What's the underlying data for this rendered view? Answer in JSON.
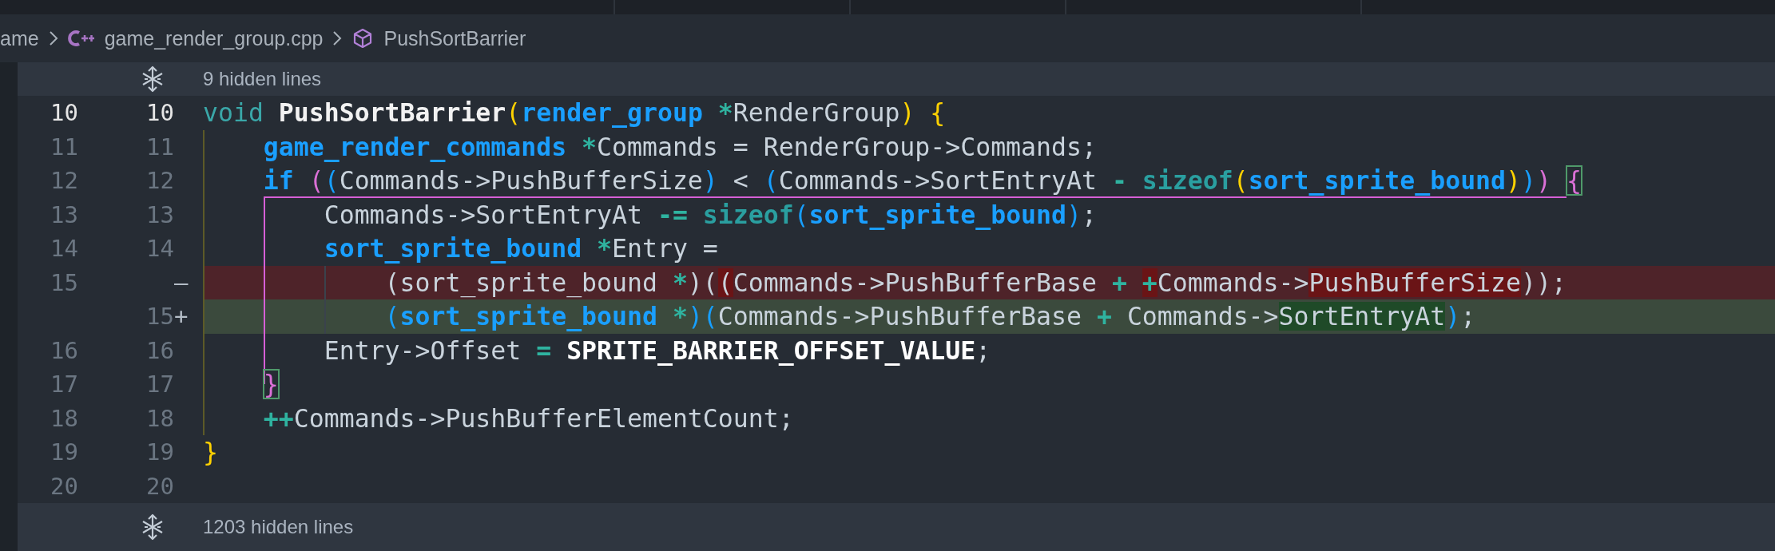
{
  "breadcrumb": [
    {
      "kind": "folder",
      "label": "ame"
    },
    {
      "kind": "file",
      "label": "game_render_group.cpp"
    },
    {
      "kind": "symbol",
      "label": "PushSortBarrier"
    }
  ],
  "top_fold": {
    "text": "9 hidden lines"
  },
  "lines": [
    {
      "old": "10",
      "new": "10",
      "kind": "context",
      "current": true,
      "tokens": [
        {
          "text": "void ",
          "kind": "keyword",
          "changed": false
        },
        {
          "text": "PushSortBarrier",
          "kind": "function",
          "changed": false
        },
        {
          "text": "(",
          "kind": "paren-1",
          "changed": false
        },
        {
          "text": "render_group ",
          "kind": "type",
          "changed": false
        },
        {
          "text": "*",
          "kind": "operator",
          "changed": false
        },
        {
          "text": "RenderGroup",
          "kind": "plain",
          "changed": false
        },
        {
          "text": ") ",
          "kind": "paren-1",
          "changed": false
        },
        {
          "text": "{",
          "kind": "paren-1",
          "changed": false
        }
      ]
    },
    {
      "old": "11",
      "new": "11",
      "kind": "context",
      "current": false,
      "tokens": [
        {
          "text": "    game_render_commands ",
          "kind": "type",
          "changed": false
        },
        {
          "text": "*",
          "kind": "operator",
          "changed": false
        },
        {
          "text": "Commands = RenderGroup->Commands;",
          "kind": "plain",
          "changed": false
        }
      ]
    },
    {
      "old": "12",
      "new": "12",
      "kind": "context",
      "current": false,
      "tokens": [
        {
          "text": "    if ",
          "kind": "control",
          "changed": false
        },
        {
          "text": "(",
          "kind": "paren-2",
          "changed": false
        },
        {
          "text": "(",
          "kind": "paren-3",
          "changed": false
        },
        {
          "text": "Commands->PushBufferSize",
          "kind": "plain",
          "changed": false
        },
        {
          "text": ")",
          "kind": "paren-3",
          "changed": false
        },
        {
          "text": " < ",
          "kind": "plain",
          "changed": false
        },
        {
          "text": "(",
          "kind": "paren-3",
          "changed": false
        },
        {
          "text": "Commands->SortEntryAt ",
          "kind": "plain",
          "changed": false
        },
        {
          "text": "- ",
          "kind": "operator",
          "changed": false
        },
        {
          "text": "sizeof",
          "kind": "builtin",
          "changed": false
        },
        {
          "text": "(",
          "kind": "paren-1",
          "changed": false
        },
        {
          "text": "sort_sprite_bound",
          "kind": "type",
          "changed": false
        },
        {
          "text": ")",
          "kind": "paren-1",
          "changed": false
        },
        {
          "text": ")",
          "kind": "paren-3",
          "changed": false
        },
        {
          "text": ") ",
          "kind": "paren-2",
          "changed": false
        },
        {
          "text": "{",
          "kind": "brace-match",
          "changed": false
        }
      ]
    },
    {
      "old": "13",
      "new": "13",
      "kind": "context",
      "current": false,
      "tokens": [
        {
          "text": "        Commands->SortEntryAt ",
          "kind": "plain",
          "changed": false
        },
        {
          "text": "-= ",
          "kind": "operator",
          "changed": false
        },
        {
          "text": "sizeof",
          "kind": "builtin",
          "changed": false
        },
        {
          "text": "(",
          "kind": "paren-3",
          "changed": false
        },
        {
          "text": "sort_sprite_bound",
          "kind": "type",
          "changed": false
        },
        {
          "text": ")",
          "kind": "paren-3",
          "changed": false
        },
        {
          "text": ";",
          "kind": "plain",
          "changed": false
        }
      ]
    },
    {
      "old": "14",
      "new": "14",
      "kind": "context",
      "current": false,
      "tokens": [
        {
          "text": "        sort_sprite_bound ",
          "kind": "type",
          "changed": false
        },
        {
          "text": "*",
          "kind": "operator",
          "changed": false
        },
        {
          "text": "Entry =",
          "kind": "plain",
          "changed": false
        }
      ]
    },
    {
      "old": "15",
      "marker": "—",
      "kind": "removed",
      "current": false,
      "tokens": [
        {
          "text": "            (sort_sprite_bound ",
          "kind": "plain",
          "changed": false
        },
        {
          "text": "*",
          "kind": "operator",
          "changed": false
        },
        {
          "text": ")(",
          "kind": "plain",
          "changed": false
        },
        {
          "text": "(",
          "kind": "plain",
          "changed": true
        },
        {
          "text": "Commands->PushBufferBase ",
          "kind": "plain",
          "changed": false
        },
        {
          "text": "+ ",
          "kind": "operator",
          "changed": false
        },
        {
          "text": "+",
          "kind": "operator",
          "changed": true
        },
        {
          "text": "Commands->",
          "kind": "plain",
          "changed": false
        },
        {
          "text": "PushBufferSize",
          "kind": "plain",
          "changed": true
        },
        {
          "text": "));",
          "kind": "plain",
          "changed": false
        }
      ]
    },
    {
      "new": "15",
      "marker": "+",
      "kind": "added",
      "current": false,
      "tokens": [
        {
          "text": "            (",
          "kind": "paren-3",
          "changed": false
        },
        {
          "text": "sort_sprite_bound ",
          "kind": "type",
          "changed": false
        },
        {
          "text": "*",
          "kind": "operator",
          "changed": false
        },
        {
          "text": ")(",
          "kind": "paren-3",
          "changed": false
        },
        {
          "text": "Commands->PushBufferBase ",
          "kind": "plain",
          "changed": false
        },
        {
          "text": "+ ",
          "kind": "operator",
          "changed": false
        },
        {
          "text": "Commands->",
          "kind": "plain",
          "changed": false
        },
        {
          "text": "SortEntryAt",
          "kind": "plain",
          "changed": true
        },
        {
          "text": ")",
          "kind": "paren-3",
          "changed": false
        },
        {
          "text": ";",
          "kind": "plain",
          "changed": false
        }
      ]
    },
    {
      "old": "16",
      "new": "16",
      "kind": "context",
      "current": false,
      "tokens": [
        {
          "text": "        Entry->Offset ",
          "kind": "plain",
          "changed": false
        },
        {
          "text": "= ",
          "kind": "operator",
          "changed": false
        },
        {
          "text": "SPRITE_BARRIER_OFFSET_VALUE",
          "kind": "constant",
          "changed": false
        },
        {
          "text": ";",
          "kind": "plain",
          "changed": false
        }
      ]
    },
    {
      "old": "17",
      "new": "17",
      "kind": "context",
      "current": false,
      "tokens": [
        {
          "text": "    }",
          "kind": "brace-match",
          "changed": false
        }
      ]
    },
    {
      "old": "18",
      "new": "18",
      "kind": "context",
      "current": false,
      "tokens": [
        {
          "text": "    ++",
          "kind": "operator",
          "changed": false
        },
        {
          "text": "Commands->PushBufferElementCount;",
          "kind": "plain",
          "changed": false
        }
      ]
    },
    {
      "old": "19",
      "new": "19",
      "kind": "context",
      "current": false,
      "tokens": [
        {
          "text": "}",
          "kind": "paren-1",
          "changed": false
        }
      ]
    },
    {
      "old": "20",
      "new": "20",
      "kind": "context",
      "current": false
    }
  ],
  "bottom_fold": {
    "text": "1203 hidden lines"
  }
}
